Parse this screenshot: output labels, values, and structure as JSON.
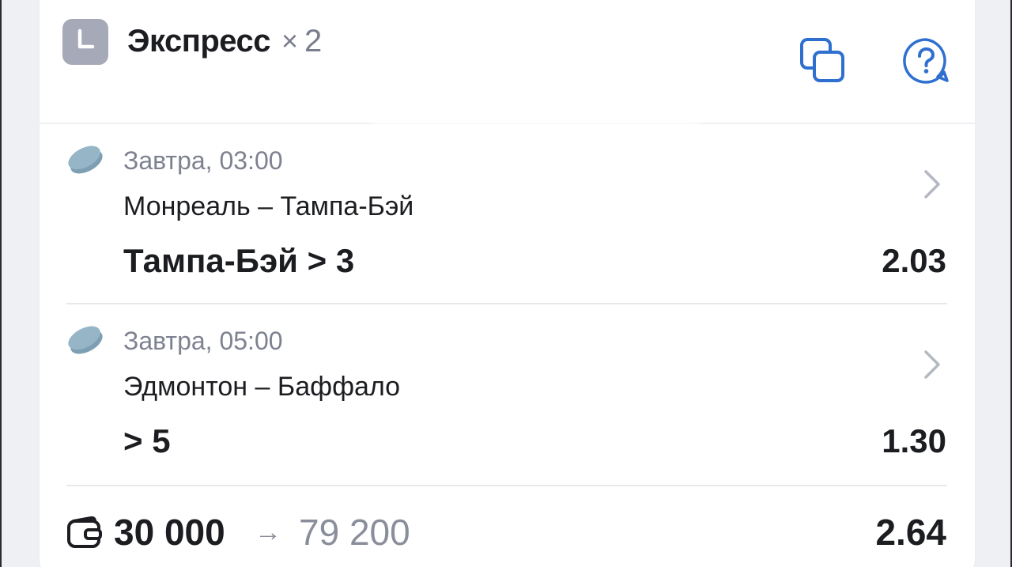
{
  "header": {
    "icon": "clock-icon",
    "title": "Экспресс",
    "multiplier_sign": "×",
    "multiplier_value": "2",
    "actions": [
      {
        "icon": "copy-icon"
      },
      {
        "icon": "help-icon"
      }
    ]
  },
  "bets": [
    {
      "sport_icon": "hockey-puck-icon",
      "time": "Завтра, 03:00",
      "match": "Монреаль – Тампа-Бэй",
      "outcome": "Тампа-Бэй > 3",
      "odds": "2.03"
    },
    {
      "sport_icon": "hockey-puck-icon",
      "time": "Завтра, 05:00",
      "match": "Эдмонтон – Баффало",
      "outcome": "> 5",
      "odds": "1.30"
    }
  ],
  "footer": {
    "wallet_icon": "wallet-icon",
    "stake": "30 000",
    "arrow": "→",
    "payout": "79 200",
    "total_odds": "2.64"
  },
  "colors": {
    "accent_blue": "#2f6fd0",
    "badge_gray": "#a6a9b7",
    "puck": "#8fb0c4",
    "muted_text": "#7e8290",
    "primary_text": "#1c1d21"
  }
}
